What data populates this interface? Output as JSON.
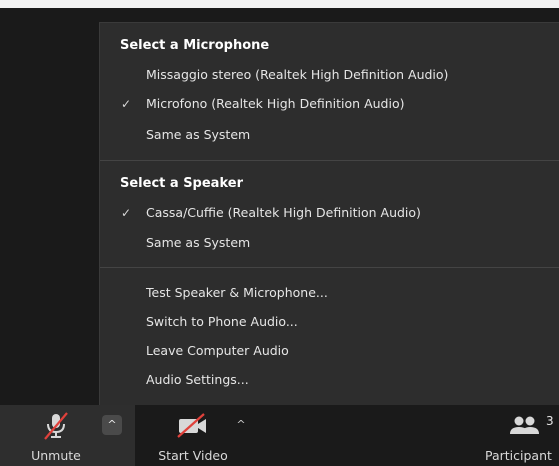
{
  "menu": {
    "microphone_heading": "Select a Microphone",
    "microphone_items": [
      {
        "label": "Missaggio stereo (Realtek High Definition Audio)",
        "checked": false
      },
      {
        "label": "Microfono (Realtek High Definition Audio)",
        "checked": true
      },
      {
        "label": "Same as System",
        "checked": false
      }
    ],
    "speaker_heading": "Select a Speaker",
    "speaker_items": [
      {
        "label": "Cassa/Cuffie (Realtek High Definition Audio)",
        "checked": true
      },
      {
        "label": "Same as System",
        "checked": false
      }
    ],
    "action_items": [
      {
        "label": "Test Speaker & Microphone..."
      },
      {
        "label": "Switch to Phone Audio..."
      },
      {
        "label": "Leave Computer Audio"
      },
      {
        "label": "Audio Settings..."
      }
    ],
    "check_glyph": "✓"
  },
  "toolbar": {
    "unmute_label": "Unmute",
    "start_video_label": "Start Video",
    "participants_label": "Participant",
    "participants_count": "3",
    "caret_glyph": "^"
  },
  "colors": {
    "menu_bg": "#2d2d2d",
    "toolbar_bg": "#1a1a1a",
    "muted_red": "#e0413b"
  },
  "icons": {
    "microphone": "microphone-muted-icon",
    "video": "video-muted-icon",
    "participants": "participants-icon",
    "check": "check-icon",
    "caret": "caret-up-icon"
  }
}
